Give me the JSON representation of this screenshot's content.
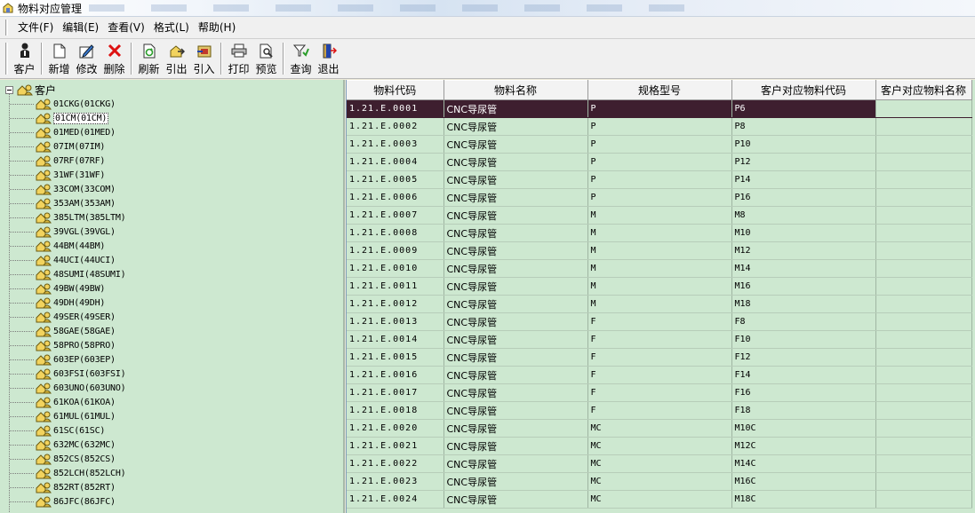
{
  "window": {
    "title": "物料对应管理"
  },
  "menu": [
    "文件(F)",
    "编辑(E)",
    "查看(V)",
    "格式(L)",
    "帮助(H)"
  ],
  "toolbar": {
    "customer": "客户",
    "add": "新增",
    "edit": "修改",
    "delete": "删除",
    "refresh": "刷新",
    "export": "引出",
    "import": "引入",
    "print": "打印",
    "preview": "预览",
    "query": "查询",
    "exit": "退出"
  },
  "tree": {
    "root": "客户",
    "items": [
      "01CKG(01CKG)",
      "01CM(01CM)",
      "01MED(01MED)",
      "07IM(07IM)",
      "07RF(07RF)",
      "31WF(31WF)",
      "33COM(33COM)",
      "353AM(353AM)",
      "385LTM(385LTM)",
      "39VGL(39VGL)",
      "44BM(44BM)",
      "44UCI(44UCI)",
      "48SUMI(48SUMI)",
      "49BW(49BW)",
      "49DH(49DH)",
      "49SER(49SER)",
      "58GAE(58GAE)",
      "58PRO(58PRO)",
      "603EP(603EP)",
      "603FSI(603FSI)",
      "603UNO(603UNO)",
      "61KOA(61KOA)",
      "61MUL(61MUL)",
      "61SC(61SC)",
      "632MC(632MC)",
      "852CS(852CS)",
      "852LCH(852LCH)",
      "852RT(852RT)",
      "86JFC(86JFC)"
    ]
  },
  "grid": {
    "columns": [
      "物料代码",
      "物料名称",
      "规格型号",
      "客户对应物料代码",
      "客户对应物料名称"
    ],
    "rows": [
      [
        "1.21.E.0001",
        "CNC导尿管",
        "P",
        "P6",
        ""
      ],
      [
        "1.21.E.0002",
        "CNC导尿管",
        "P",
        "P8",
        ""
      ],
      [
        "1.21.E.0003",
        "CNC导尿管",
        "P",
        "P10",
        ""
      ],
      [
        "1.21.E.0004",
        "CNC导尿管",
        "P",
        "P12",
        ""
      ],
      [
        "1.21.E.0005",
        "CNC导尿管",
        "P",
        "P14",
        ""
      ],
      [
        "1.21.E.0006",
        "CNC导尿管",
        "P",
        "P16",
        ""
      ],
      [
        "1.21.E.0007",
        "CNC导尿管",
        "M",
        "M8",
        ""
      ],
      [
        "1.21.E.0008",
        "CNC导尿管",
        "M",
        "M10",
        ""
      ],
      [
        "1.21.E.0009",
        "CNC导尿管",
        "M",
        "M12",
        ""
      ],
      [
        "1.21.E.0010",
        "CNC导尿管",
        "M",
        "M14",
        ""
      ],
      [
        "1.21.E.0011",
        "CNC导尿管",
        "M",
        "M16",
        ""
      ],
      [
        "1.21.E.0012",
        "CNC导尿管",
        "M",
        "M18",
        ""
      ],
      [
        "1.21.E.0013",
        "CNC导尿管",
        "F",
        "F8",
        ""
      ],
      [
        "1.21.E.0014",
        "CNC导尿管",
        "F",
        "F10",
        ""
      ],
      [
        "1.21.E.0015",
        "CNC导尿管",
        "F",
        "F12",
        ""
      ],
      [
        "1.21.E.0016",
        "CNC导尿管",
        "F",
        "F14",
        ""
      ],
      [
        "1.21.E.0017",
        "CNC导尿管",
        "F",
        "F16",
        ""
      ],
      [
        "1.21.E.0018",
        "CNC导尿管",
        "F",
        "F18",
        ""
      ],
      [
        "1.21.E.0020",
        "CNC导尿管",
        "MC",
        "M10C",
        ""
      ],
      [
        "1.21.E.0021",
        "CNC导尿管",
        "MC",
        "M12C",
        ""
      ],
      [
        "1.21.E.0022",
        "CNC导尿管",
        "MC",
        "M14C",
        ""
      ],
      [
        "1.21.E.0023",
        "CNC导尿管",
        "MC",
        "M16C",
        ""
      ],
      [
        "1.21.E.0024",
        "CNC导尿管",
        "MC",
        "M18C",
        ""
      ]
    ]
  },
  "colors": {
    "pane_bg": "#cde8d0",
    "selection": "#3e1f2f"
  }
}
